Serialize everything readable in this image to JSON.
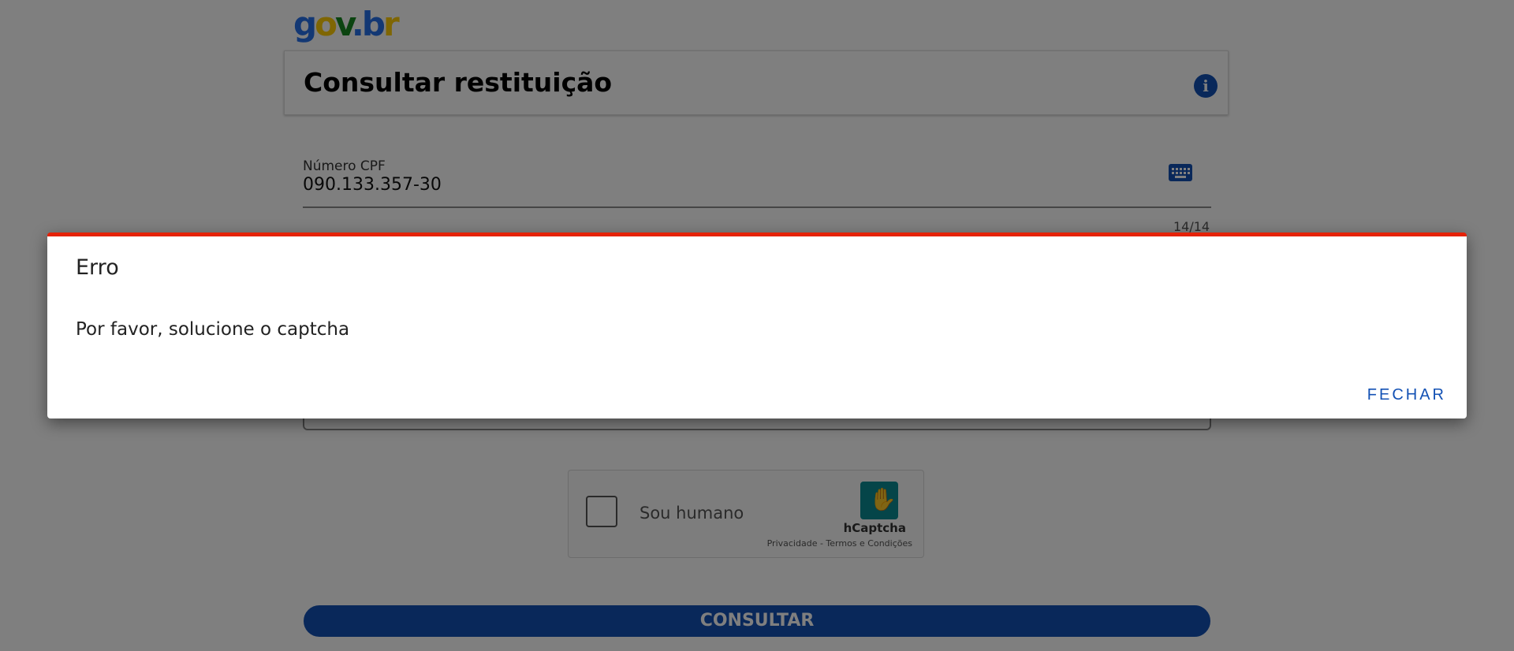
{
  "header": {
    "logo": {
      "g": "g",
      "o": "o",
      "v": "v",
      "dot": ".",
      "b": "b",
      "r": "r"
    }
  },
  "title_card": {
    "title": "Consultar restituição",
    "info_icon": "i"
  },
  "cpf_field": {
    "label": "Número CPF",
    "value": "090.133.357-30",
    "counter": "14/14"
  },
  "captcha": {
    "label": "Sou humano",
    "brand": "hCaptcha",
    "links": "Privacidade - Termos e Condições"
  },
  "submit": {
    "label": "CONSULTAR"
  },
  "dialog": {
    "title": "Erro",
    "message": "Por favor, solucione o captcha",
    "close_label": "FECHAR"
  },
  "colors": {
    "primary": "#1351b4",
    "error": "#e52207",
    "overlay": "rgba(0,0,0,0.5)"
  }
}
